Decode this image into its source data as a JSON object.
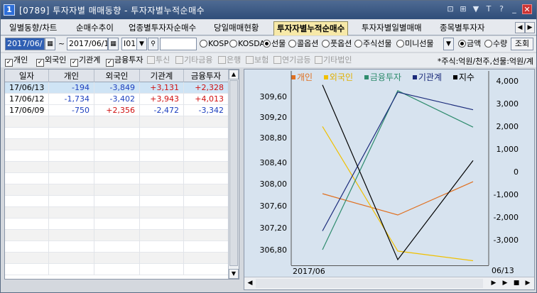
{
  "window": {
    "title": "[0789]  투자자별 매매동향 - 투자자별누적순매수",
    "icon_label": "1",
    "buttons": [
      "⊡",
      "⊞",
      "▼",
      "T",
      "?",
      "_",
      "✕"
    ]
  },
  "tabs": [
    {
      "label": "일별동향/차트"
    },
    {
      "label": "순매수추이"
    },
    {
      "label": "업종별투자자순매수"
    },
    {
      "label": "당일매매현황"
    },
    {
      "label": "투자자별누적순매수",
      "active": true
    },
    {
      "label": "투자자별일별매매"
    },
    {
      "label": "종목별투자자"
    }
  ],
  "tab_nav": [
    "◀",
    "▶"
  ],
  "toolbar1": {
    "date_from": "2017/06/",
    "separator": "~",
    "date_to": "2017/06/1",
    "code": "I01",
    "radios": [
      {
        "label": "KOSP",
        "checked": false
      },
      {
        "label": "KOSDA",
        "checked": false
      },
      {
        "label": "선물",
        "checked": true
      },
      {
        "label": "콜옵션",
        "checked": false
      },
      {
        "label": "풋옵션",
        "checked": false
      },
      {
        "label": "주식선물",
        "checked": false
      },
      {
        "label": "미니선물",
        "checked": false
      }
    ],
    "amount_radios": [
      {
        "label": "금액",
        "checked": true
      },
      {
        "label": "수량",
        "checked": false
      }
    ],
    "query_button": "조회"
  },
  "toolbar2": {
    "checks": [
      {
        "label": "개인",
        "checked": true
      },
      {
        "label": "외국인",
        "checked": true
      },
      {
        "label": "기관계",
        "checked": true
      },
      {
        "label": "금융투자",
        "checked": true
      },
      {
        "label": "투신",
        "checked": false
      },
      {
        "label": "기타금융",
        "checked": false
      },
      {
        "label": "은행",
        "checked": false
      },
      {
        "label": "보험",
        "checked": false
      },
      {
        "label": "연기금등",
        "checked": false
      },
      {
        "label": "기타법인",
        "checked": false
      }
    ],
    "unit_note": "*주식:억원/천주,선물:억원/계"
  },
  "grid": {
    "columns": [
      "일자",
      "개인",
      "외국인",
      "기관계",
      "금융투자"
    ],
    "rows": [
      {
        "date": "17/06/13",
        "values": [
          "-194",
          "-3,849",
          "+3,131",
          "+2,328"
        ]
      },
      {
        "date": "17/06/12",
        "values": [
          "-1,734",
          "-3,402",
          "+3,943",
          "+4,013"
        ]
      },
      {
        "date": "17/06/09",
        "values": [
          "-750",
          "+2,356",
          "-2,472",
          "-3,342"
        ]
      }
    ]
  },
  "chart_data": {
    "type": "line",
    "legend": [
      "개인",
      "외국인",
      "금융투자",
      "기관계",
      "지수"
    ],
    "colors": {
      "개인": "#e07020",
      "외국인": "#f0c000",
      "금융투자": "#2f8c6e",
      "기관계": "#1a2a7a",
      "지수": "#000000"
    },
    "x": [
      "17/06/09",
      "17/06/12",
      "17/06/13"
    ],
    "x_label_start": "2017/06",
    "x_label_end": "06/13",
    "y_left_ticks": [
      "309,60",
      "309,20",
      "308,80",
      "308,40",
      "308,00",
      "307,60",
      "307,20",
      "306,80"
    ],
    "y_right_ticks": [
      "4,000",
      "3,000",
      "2,000",
      "1,000",
      "0",
      "-1,000",
      "-2,000",
      "-3,000"
    ],
    "y_right_range": [
      -3800,
      4400
    ],
    "y_left_range": [
      306.5,
      309.9
    ],
    "series": [
      {
        "name": "개인",
        "axis": "right",
        "values": [
          -750,
          -1734,
          -194
        ]
      },
      {
        "name": "외국인",
        "axis": "right",
        "values": [
          2356,
          -3402,
          -3849
        ]
      },
      {
        "name": "금융투자",
        "axis": "right",
        "values": [
          -3342,
          4013,
          2328
        ]
      },
      {
        "name": "기관계",
        "axis": "right",
        "values": [
          -2472,
          3943,
          3131
        ]
      },
      {
        "name": "지수",
        "axis": "left",
        "values": [
          309.85,
          306.5,
          308.4
        ]
      }
    ]
  }
}
